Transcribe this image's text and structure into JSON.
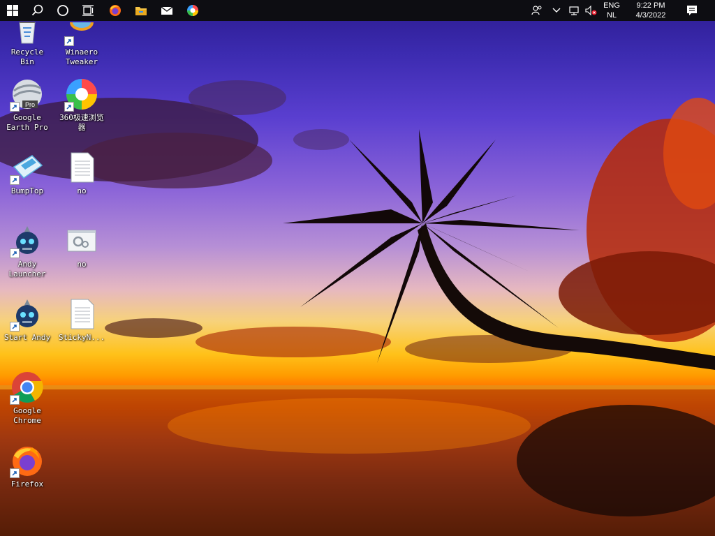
{
  "taskbar": {
    "apps": [
      "start-button",
      "search-button",
      "cortana-button",
      "task-view-button",
      "firefox-pinned",
      "file-explorer-pinned",
      "mail-pinned",
      "browser-360-pinned"
    ],
    "tray": {
      "language_line1": "ENG",
      "language_line2": "NL",
      "time": "9:22 PM",
      "date": "4/3/2022"
    }
  },
  "desktop": {
    "icons": [
      {
        "label": "Recycle\nBin"
      },
      {
        "label": "Winaero\nTweaker"
      },
      {
        "label": "Google\nEarth Pro"
      },
      {
        "label": "360极速浏览\n器"
      },
      {
        "label": "BumpTop"
      },
      {
        "label": "no"
      },
      {
        "label": "Andy\nLauncher"
      },
      {
        "label": "no"
      },
      {
        "label": "Start Andy"
      },
      {
        "label": "StickyN..."
      },
      {
        "label": "Google\nChrome"
      },
      {
        "label": "Firefox"
      }
    ]
  },
  "colors": {
    "taskbar_bg": "#0d0d12",
    "label_text": "#ffffff"
  }
}
